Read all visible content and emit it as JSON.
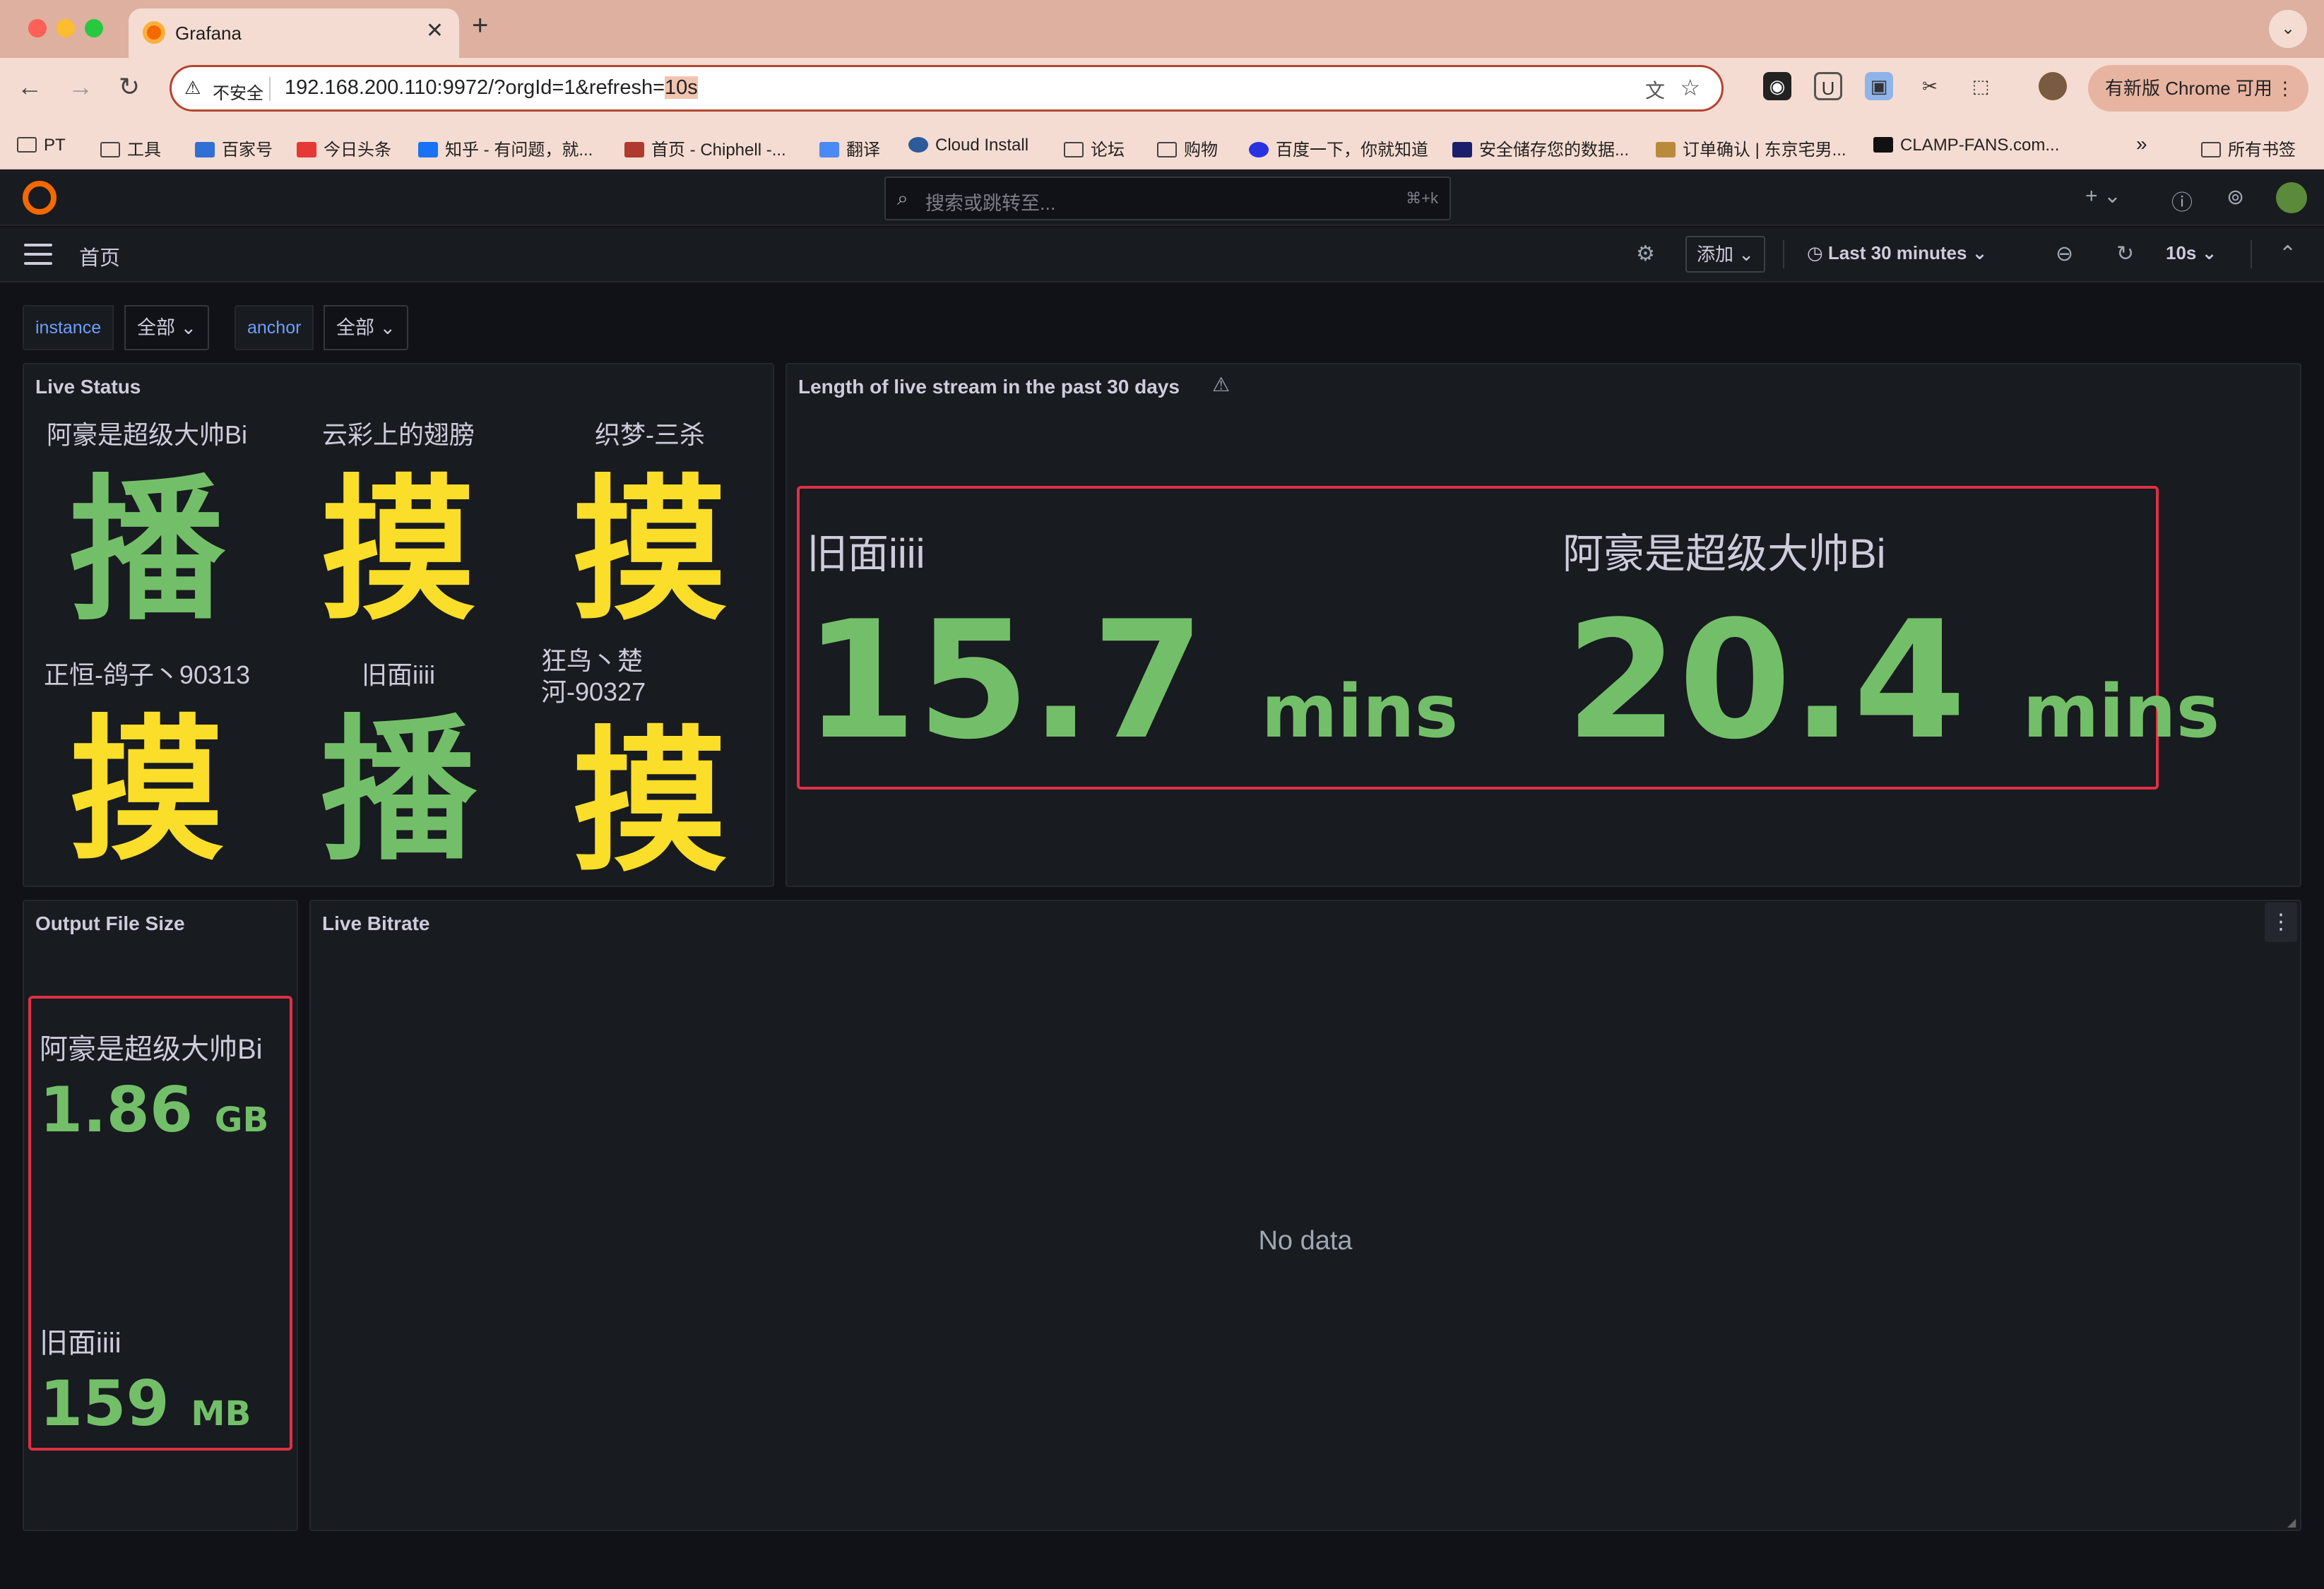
{
  "browser": {
    "tab_title": "Grafana",
    "url_prefix": "192.168.200.110:9972/?orgId=1&refresh=",
    "url_highlight": "10s",
    "insecure_label": "不安全",
    "update_button": "有新版 Chrome 可用",
    "bookmarks": [
      {
        "label": "PT",
        "icon": "folder-icon"
      },
      {
        "label": "工具",
        "icon": "folder-icon"
      },
      {
        "label": "百家号",
        "icon": "baijiahao-icon"
      },
      {
        "label": "今日头条",
        "icon": "toutiao-icon"
      },
      {
        "label": "知乎 - 有问题，就...",
        "icon": "zhihu-icon"
      },
      {
        "label": "首页 - Chiphell -...",
        "icon": "chiphell-icon"
      },
      {
        "label": "翻译",
        "icon": "translate-icon"
      },
      {
        "label": "Cloud Install",
        "icon": "cloud-icon"
      },
      {
        "label": "论坛",
        "icon": "folder-icon"
      },
      {
        "label": "购物",
        "icon": "folder-icon"
      },
      {
        "label": "百度一下，你就知道",
        "icon": "baidu-icon"
      },
      {
        "label": "安全储存您的数据...",
        "icon": "storage-icon"
      },
      {
        "label": "订单确认 | 东京宅男...",
        "icon": "order-icon"
      },
      {
        "label": "CLAMP-FANS.com...",
        "icon": "clamp-icon"
      }
    ],
    "all_bookmarks": "所有书签"
  },
  "grafana": {
    "search_placeholder": "搜索或跳转至...",
    "search_shortcut": "⌘+k",
    "breadcrumb": "首页",
    "add_button": "添加",
    "time_range": "Last 30 minutes",
    "refresh_interval": "10s",
    "variables": [
      {
        "label": "instance",
        "value": "全部"
      },
      {
        "label": "anchor",
        "value": "全部"
      }
    ]
  },
  "panels": {
    "live_status": {
      "title": "Live Status",
      "items": [
        {
          "name": "阿豪是超级大帅Bi",
          "status": "播",
          "color": "#73bf69"
        },
        {
          "name": "云彩上的翅膀",
          "status": "摸",
          "color": "#fade2a"
        },
        {
          "name": "织梦-三杀",
          "status": "摸",
          "color": "#fade2a"
        },
        {
          "name": "正恒-鸽子丶90313",
          "status": "摸",
          "color": "#fade2a"
        },
        {
          "name": "旧面iiii",
          "status": "播",
          "color": "#73bf69"
        },
        {
          "name_line1": "狂鸟丶楚",
          "name_line2": "河-90327",
          "status": "摸",
          "color": "#fade2a"
        }
      ]
    },
    "stream_length": {
      "title": "Length of live stream in the past 30 days",
      "items": [
        {
          "name": "旧面iiii",
          "value": "15.7",
          "unit": "mins"
        },
        {
          "name": "阿豪是超级大帅Bi",
          "value": "20.4",
          "unit": "mins"
        }
      ]
    },
    "output_file_size": {
      "title": "Output File Size",
      "items": [
        {
          "name": "阿豪是超级大帅Bi",
          "value": "1.86",
          "unit": "GB"
        },
        {
          "name": "旧面iiii",
          "value": "159",
          "unit": "MB"
        }
      ]
    },
    "live_bitrate": {
      "title": "Live Bitrate",
      "empty_message": "No data"
    }
  }
}
